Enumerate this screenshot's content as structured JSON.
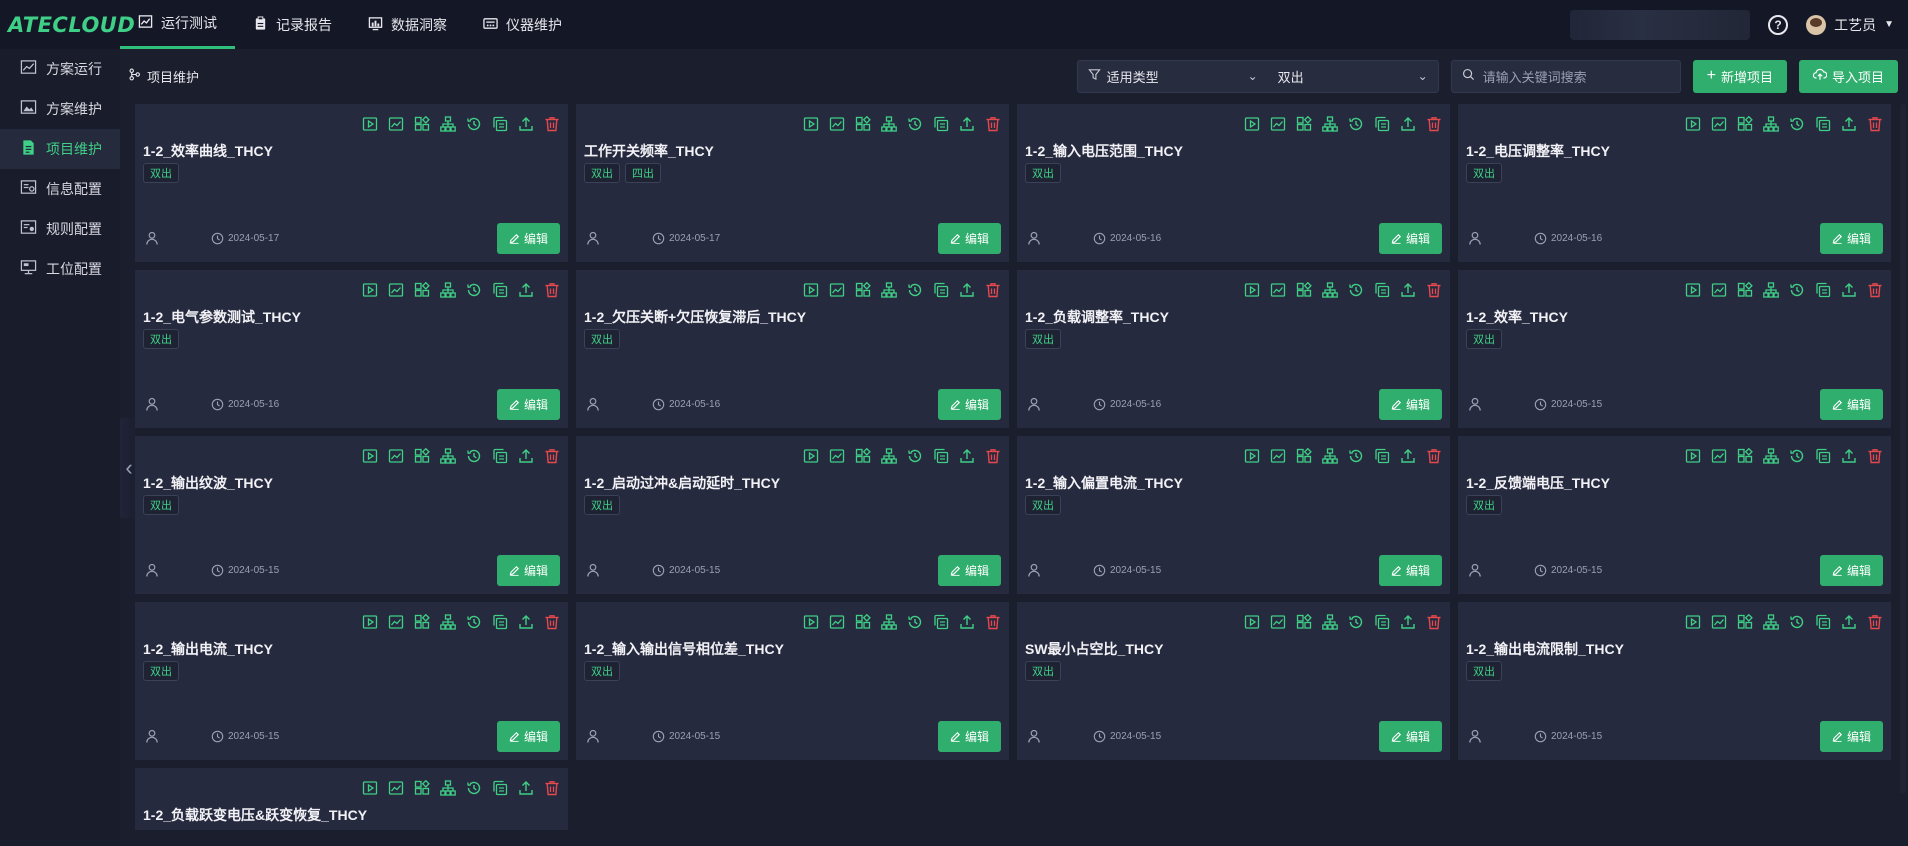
{
  "app": {
    "logo": "ATECLOUD"
  },
  "topnav": [
    {
      "label": "运行测试",
      "icon": "chart-line-icon",
      "active": true
    },
    {
      "label": "记录报告",
      "icon": "clipboard-icon",
      "active": false
    },
    {
      "label": "数据洞察",
      "icon": "bar-chart-icon",
      "active": false
    },
    {
      "label": "仪器维护",
      "icon": "instrument-icon",
      "active": false
    }
  ],
  "user": {
    "name": "工艺员",
    "help": "?"
  },
  "sidebar": [
    {
      "label": "方案运行",
      "icon": "chart-window-icon",
      "active": false
    },
    {
      "label": "方案维护",
      "icon": "image-window-icon",
      "active": false
    },
    {
      "label": "项目维护",
      "icon": "document-icon",
      "active": true
    },
    {
      "label": "信息配置",
      "icon": "settings-list-icon",
      "active": false
    },
    {
      "label": "规则配置",
      "icon": "rule-settings-icon",
      "active": false
    },
    {
      "label": "工位配置",
      "icon": "monitor-icon",
      "active": false
    }
  ],
  "toolbar": {
    "breadcrumb": "项目维护",
    "filter_type_label": "适用类型",
    "filter_value": "双出",
    "search_placeholder": "请输入关键词搜索",
    "add_label": "新增项目",
    "import_label": "导入项目"
  },
  "colors": {
    "accent": "#2fae6d",
    "accent_text": "#3fcf86",
    "danger": "#e5484d",
    "card_bg": "#262a3e"
  },
  "card_icons": [
    "play-icon",
    "chart-icon",
    "grid-icon",
    "hierarchy-icon",
    "history-icon",
    "copy-icon",
    "upload-icon",
    "delete-icon"
  ],
  "edit_label": "编辑",
  "cards": [
    {
      "title": "1-2_效率曲线_THCY",
      "tags": [
        "双出"
      ],
      "date": "2024-05-17"
    },
    {
      "title": "工作开关频率_THCY",
      "tags": [
        "双出",
        "四出"
      ],
      "date": "2024-05-17"
    },
    {
      "title": "1-2_输入电压范围_THCY",
      "tags": [
        "双出"
      ],
      "date": "2024-05-16"
    },
    {
      "title": "1-2_电压调整率_THCY",
      "tags": [
        "双出"
      ],
      "date": "2024-05-16"
    },
    {
      "title": "1-2_电气参数测试_THCY",
      "tags": [
        "双出"
      ],
      "date": "2024-05-16"
    },
    {
      "title": "1-2_欠压关断+欠压恢复滞后_THCY",
      "tags": [
        "双出"
      ],
      "date": "2024-05-16"
    },
    {
      "title": "1-2_负载调整率_THCY",
      "tags": [
        "双出"
      ],
      "date": "2024-05-16"
    },
    {
      "title": "1-2_效率_THCY",
      "tags": [
        "双出"
      ],
      "date": "2024-05-15"
    },
    {
      "title": "1-2_输出纹波_THCY",
      "tags": [
        "双出"
      ],
      "date": "2024-05-15"
    },
    {
      "title": "1-2_启动过冲&启动延时_THCY",
      "tags": [
        "双出"
      ],
      "date": "2024-05-15"
    },
    {
      "title": "1-2_输入偏置电流_THCY",
      "tags": [
        "双出"
      ],
      "date": "2024-05-15"
    },
    {
      "title": "1-2_反馈端电压_THCY",
      "tags": [
        "双出"
      ],
      "date": "2024-05-15"
    },
    {
      "title": "1-2_输出电流_THCY",
      "tags": [
        "双出"
      ],
      "date": "2024-05-15"
    },
    {
      "title": "1-2_输入输出信号相位差_THCY",
      "tags": [
        "双出"
      ],
      "date": "2024-05-15"
    },
    {
      "title": "SW最小占空比_THCY",
      "tags": [
        "双出"
      ],
      "date": "2024-05-15"
    },
    {
      "title": "1-2_输出电流限制_THCY",
      "tags": [
        "双出"
      ],
      "date": "2024-05-15"
    },
    {
      "title": "1-2_负载跃变电压&跃变恢复_THCY",
      "tags": [],
      "date": ""
    }
  ]
}
